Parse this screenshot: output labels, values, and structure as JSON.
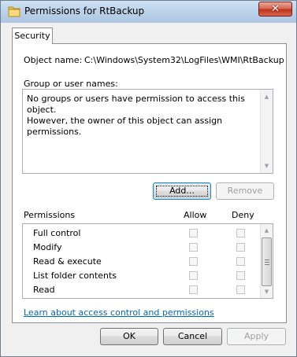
{
  "window": {
    "title": "Permissions for RtBackup",
    "close_glyph": "✕"
  },
  "tabs": [
    {
      "label": "Security"
    }
  ],
  "object": {
    "label": "Object name:",
    "value": "C:\\Windows\\System32\\LogFiles\\WMI\\RtBackup"
  },
  "groups": {
    "label": "Group or user names:",
    "message_line1": "No groups or users have permission to access this object.",
    "message_line2": "However, the owner of this object can assign permissions."
  },
  "buttons": {
    "add": "Add...",
    "remove": "Remove",
    "ok": "OK",
    "cancel": "Cancel",
    "apply": "Apply"
  },
  "permissions": {
    "label": "Permissions",
    "allow_header": "Allow",
    "deny_header": "Deny",
    "rows": [
      {
        "name": "Full control",
        "allow": false,
        "deny": false
      },
      {
        "name": "Modify",
        "allow": false,
        "deny": false
      },
      {
        "name": "Read & execute",
        "allow": false,
        "deny": false
      },
      {
        "name": "List folder contents",
        "allow": false,
        "deny": false
      },
      {
        "name": "Read",
        "allow": false,
        "deny": false
      }
    ]
  },
  "link": {
    "text": "Learn about access control and permissions"
  },
  "colors": {
    "link": "#0066cc",
    "titlebar": "#bdd3ea",
    "close_button": "#c0341b"
  },
  "icons": {
    "title": "folder-icon",
    "close": "close-icon"
  }
}
